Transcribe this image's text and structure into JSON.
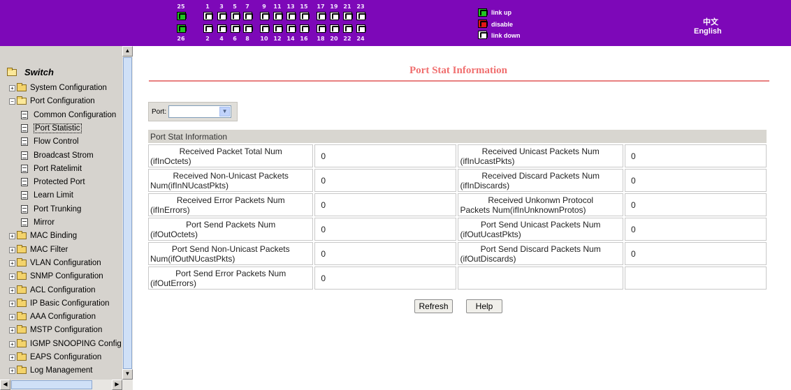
{
  "topbar": {
    "ports_top_labels": [
      "25",
      "1",
      "3",
      "5",
      "7",
      "9",
      "11",
      "13",
      "15",
      "17",
      "19",
      "21",
      "23"
    ],
    "ports_bottom_labels": [
      "26",
      "2",
      "4",
      "6",
      "8",
      "10",
      "12",
      "14",
      "16",
      "18",
      "20",
      "22",
      "24"
    ],
    "legend": {
      "link_up": "link up",
      "disable": "disable",
      "link_down": "link down"
    },
    "lang": {
      "chinese": "中文",
      "english": "English"
    },
    "colors": {
      "banner": "#7d08b8",
      "link_up": "#22c422",
      "disable": "#e21616",
      "link_down": "#ffffff"
    }
  },
  "sidebar": {
    "root": "Switch",
    "items": [
      {
        "label": "System Configuration",
        "type": "folder",
        "expander": "+"
      },
      {
        "label": "Port Configuration",
        "type": "folder-open",
        "expander": "−"
      },
      {
        "label": "Common Configuration",
        "type": "doc"
      },
      {
        "label": "Port Statistic",
        "type": "doc",
        "selected": true
      },
      {
        "label": "Flow Control",
        "type": "doc"
      },
      {
        "label": "Broadcast Strom",
        "type": "doc"
      },
      {
        "label": "Port Ratelimit",
        "type": "doc"
      },
      {
        "label": "Protected Port",
        "type": "doc"
      },
      {
        "label": "Learn Limit",
        "type": "doc"
      },
      {
        "label": "Port Trunking",
        "type": "doc"
      },
      {
        "label": "Mirror",
        "type": "doc"
      },
      {
        "label": "MAC Binding",
        "type": "folder",
        "expander": "+"
      },
      {
        "label": "MAC Filter",
        "type": "folder",
        "expander": "+"
      },
      {
        "label": "VLAN Configuration",
        "type": "folder",
        "expander": "+"
      },
      {
        "label": "SNMP Configuration",
        "type": "folder",
        "expander": "+"
      },
      {
        "label": "ACL Configuration",
        "type": "folder",
        "expander": "+"
      },
      {
        "label": "IP Basic Configuration",
        "type": "folder",
        "expander": "+"
      },
      {
        "label": "AAA Configuration",
        "type": "folder",
        "expander": "+"
      },
      {
        "label": "MSTP Configuration",
        "type": "folder",
        "expander": "+"
      },
      {
        "label": "IGMP SNOOPING Config",
        "type": "folder",
        "expander": "+"
      },
      {
        "label": "EAPS Configuration",
        "type": "folder",
        "expander": "+"
      },
      {
        "label": "Log Management",
        "type": "folder",
        "expander": "+"
      }
    ]
  },
  "main": {
    "title": "Port Stat Information",
    "port_label": "Port:",
    "port_value": "",
    "table_header": "Port Stat Information",
    "rows": [
      [
        {
          "label": [
            "Received Packet Total Num",
            "(ifInOctets)"
          ],
          "value": "0"
        },
        {
          "label": [
            "Received Unicast Packets Num",
            "(ifInUcastPkts)"
          ],
          "value": "0"
        }
      ],
      [
        {
          "label": [
            "Received Non-Unicast Packets",
            "Num(ifInNUcastPkts)"
          ],
          "value": "0"
        },
        {
          "label": [
            "Received Discard Packets Num",
            "(ifInDiscards)"
          ],
          "value": "0"
        }
      ],
      [
        {
          "label": [
            "Received Error Packets Num",
            "(ifInErrors)"
          ],
          "value": "0"
        },
        {
          "label": [
            "Received Unkonwn Protocol",
            "Packets Num(ifInUnknownProtos)"
          ],
          "value": "0"
        }
      ],
      [
        {
          "label": [
            "Port Send Packets Num",
            "(ifOutOctets)"
          ],
          "value": "0"
        },
        {
          "label": [
            "Port Send Unicast Packets Num",
            "(ifOutUcastPkts)"
          ],
          "value": "0"
        }
      ],
      [
        {
          "label": [
            "Port Send Non-Unicast Packets",
            "Num(ifOutNUcastPkts)"
          ],
          "value": "0"
        },
        {
          "label": [
            "Port Send Discard Packets Num",
            "(ifOutDiscards)"
          ],
          "value": "0"
        }
      ],
      [
        {
          "label": [
            "Port Send Error Packets Num",
            "(ifOutErrors)"
          ],
          "value": "0"
        },
        {
          "label": [
            "",
            ""
          ],
          "value": ""
        }
      ]
    ],
    "buttons": {
      "refresh": "Refresh",
      "help": "Help"
    },
    "colors": {
      "title": "#f06f6f"
    }
  }
}
